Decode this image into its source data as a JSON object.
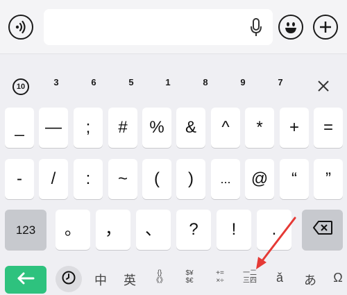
{
  "number_row": {
    "circled_ten": "⑩",
    "digits": [
      "3",
      "6",
      "5",
      "1",
      "8",
      "9",
      "7"
    ]
  },
  "rows": {
    "row1": [
      "_",
      "—",
      ";",
      "#",
      "%",
      "&",
      "^",
      "*",
      "+",
      "="
    ],
    "row2": [
      "-",
      "/",
      ":",
      "~",
      "(",
      ")",
      "...",
      "@",
      "“",
      "”"
    ],
    "row3": [
      "123",
      "。",
      "，",
      "、",
      "?",
      "!",
      "."
    ]
  },
  "bottom_bar": {
    "chinese": "中",
    "english": "英",
    "brackets": "{}\n《》",
    "currency": "$¥\n$€",
    "math": "+=\n×÷",
    "list": "一二\n三四",
    "accent": "ǎ",
    "japanese": "あ",
    "more": "Ω"
  },
  "colors": {
    "enter_key": "#2ec27e",
    "annotation_arrow": "#e53935"
  },
  "icons": [
    "voice-icon",
    "mic-icon",
    "emoji-icon",
    "plus-icon",
    "close-icon",
    "backspace-icon",
    "enter-arrow-icon",
    "clock-icon"
  ]
}
